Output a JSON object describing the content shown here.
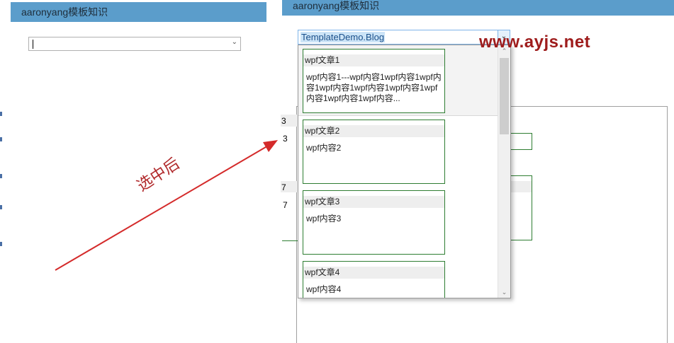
{
  "left_window": {
    "title": "aaronyang模板知识",
    "combo": {
      "value": ""
    }
  },
  "right_window": {
    "title": "aaronyang模板知识",
    "combo": {
      "selected_text": "TemplateDemo.Blog",
      "items": [
        {
          "title": "wpf文章1",
          "body": "wpf内容1---wpf内容1wpf内容1wpf内容1wpf内容1wpf内容1wpf内容1wpf内容1wpf内容1wpf内容..."
        },
        {
          "title": "wpf文章2",
          "body": "wpf内容2"
        },
        {
          "title": "wpf文章3",
          "body": "wpf内容3"
        },
        {
          "title": "wpf文章4",
          "body": "wpf内容4"
        }
      ]
    },
    "background_fragments": [
      "3",
      "3",
      "7",
      "7"
    ]
  },
  "watermark": "www.ayjs.net",
  "annotation": "选中后",
  "colors": {
    "titlebar": "#5b9dcb",
    "card_border": "#2e7d32",
    "annotation": "#b0282a",
    "watermark": "#9e1c1c",
    "selection": "#cce4f7"
  },
  "icons": {
    "combo_dropdown": "chevron-down-icon",
    "scroll_up": "chevron-up-icon",
    "scroll_down": "chevron-down-icon"
  }
}
